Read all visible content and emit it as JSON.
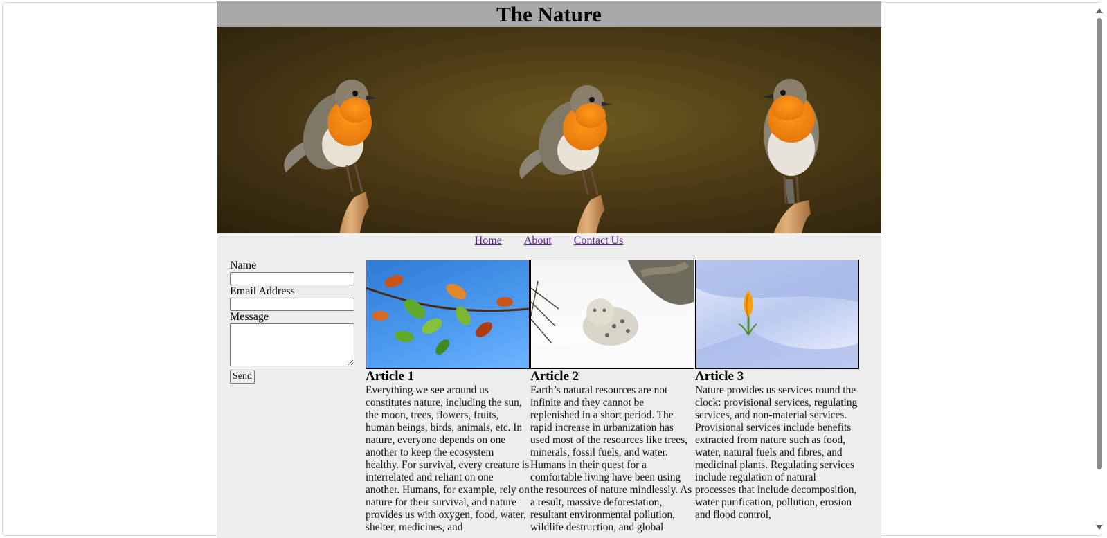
{
  "page": {
    "title": "The Nature"
  },
  "nav": {
    "items": [
      {
        "label": "Home"
      },
      {
        "label": "About"
      },
      {
        "label": "Contact Us"
      }
    ]
  },
  "form": {
    "name_label": "Name",
    "name_value": "",
    "email_label": "Email Address",
    "email_value": "",
    "message_label": "Message",
    "message_value": "",
    "send_label": "Send"
  },
  "articles": [
    {
      "title": "Article 1",
      "image": "autumn-leaves",
      "text": "Everything we see around us constitutes nature, including the sun, the moon, trees, flowers, fruits, human beings, birds, animals, etc. In nature, everyone depends on one another to keep the ecosystem healthy. For survival, every creature is interrelated and reliant on one another. Humans, for example, rely on nature for their survival, and nature provides us with oxygen, food, water, shelter, medicines, and"
    },
    {
      "title": "Article 2",
      "image": "snow-leopard",
      "text": "Earth’s natural resources are not infinite and they cannot be replenished in a short period. The rapid increase in urbanization has used most of the resources like trees, minerals, fossil fuels, and water. Humans in their quest for a comfortable living have been using the resources of nature mindlessly. As a result, massive deforestation, resultant environmental pollution, wildlife destruction, and global"
    },
    {
      "title": "Article 3",
      "image": "crocus-in-snow",
      "text": "Nature provides us services round the clock: provisional services, regulating services, and non-material services. Provisional services include benefits extracted from nature such as food, water, natural fuels and fibres, and medicinal plants. Regulating services include regulation of natural processes that include decomposition, water purification, pollution, erosion and flood control,"
    }
  ],
  "colors": {
    "title_bar": "#a8a8a8",
    "page_bg": "#ededed",
    "link": "#551a8b"
  }
}
